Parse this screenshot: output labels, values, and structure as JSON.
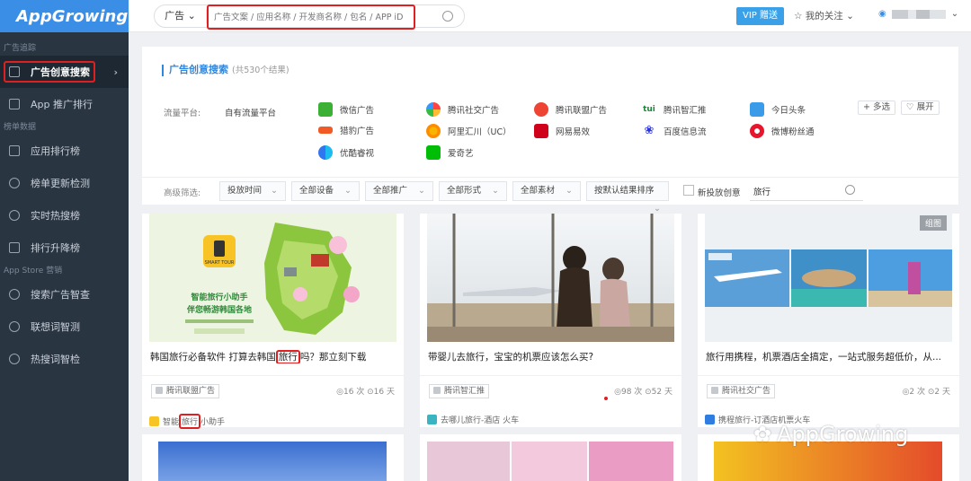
{
  "logo": "AppGrowing",
  "sidebar": {
    "sections": [
      {
        "title": "广告追踪",
        "items": [
          {
            "label": "广告创意搜索",
            "active": true
          },
          {
            "label": "App 推广排行",
            "active": false
          }
        ]
      },
      {
        "title": "榜单数据",
        "items": [
          {
            "label": "应用排行榜"
          },
          {
            "label": "榜单更新检测"
          },
          {
            "label": "实时热搜榜"
          },
          {
            "label": "排行升降榜"
          }
        ]
      },
      {
        "title": "App Store 营销",
        "items": [
          {
            "label": "搜索广告智查"
          },
          {
            "label": "联想词智测"
          },
          {
            "label": "热搜词智检"
          }
        ]
      }
    ]
  },
  "header": {
    "search_type": "广告",
    "search_placeholder": "广告文案 / 应用名称 / 开发商名称 / 包名 / APP iD",
    "vip_label": "VIP 赠送",
    "follow_label": "我的关注"
  },
  "panel": {
    "title": "广告创意搜索",
    "count_text": "(共530个结果)",
    "flow_label": "流量平台:",
    "self_platform": "自有流量平台",
    "platforms": [
      "微信广告",
      "腾讯社交广告",
      "腾讯联盟广告",
      "腾讯智汇推",
      "今日头条",
      "猎豹广告",
      "阿里汇川（UC）",
      "网易易效",
      "百度信息流",
      "微博粉丝通",
      "优酷睿视",
      "爱奇艺"
    ],
    "multi_select": "+ 多选",
    "expand": "展开",
    "filter_label": "高级筛选:",
    "dropdowns": [
      "投放时间",
      "全部设备",
      "全部推广",
      "全部形式",
      "全部素材",
      "按默认结果排序"
    ],
    "new_label": "新投放创意",
    "keyword": "旅行"
  },
  "cards": [
    {
      "poster_title": "智能旅行小助手",
      "poster_sub": "伴您畅游韩国各地",
      "title_before": "韩国旅行必备软件 打算去韩国",
      "title_hl": "旅行",
      "title_after": "吗？那立刻下载",
      "tag": "腾讯联盟广告",
      "stats": "◎16 次  ⊙16 天",
      "app_before": "智能",
      "app_hl": "旅行",
      "app_after": "小助手"
    },
    {
      "title": "带婴儿去旅行，宝宝的机票应该怎么买?",
      "tag": "腾讯智汇推",
      "stats": "◎98 次  ⊙52 天",
      "app": "去哪儿旅行-酒店 火车"
    },
    {
      "badge": "组图",
      "title": "旅行用携程，机票酒店全搞定，一站式服务超低价，从...",
      "tag": "腾讯社交广告",
      "stats": "◎2 次  ⊙2 天",
      "app": "携程旅行-订酒店机票火车"
    }
  ],
  "watermark": "AppGrowing"
}
